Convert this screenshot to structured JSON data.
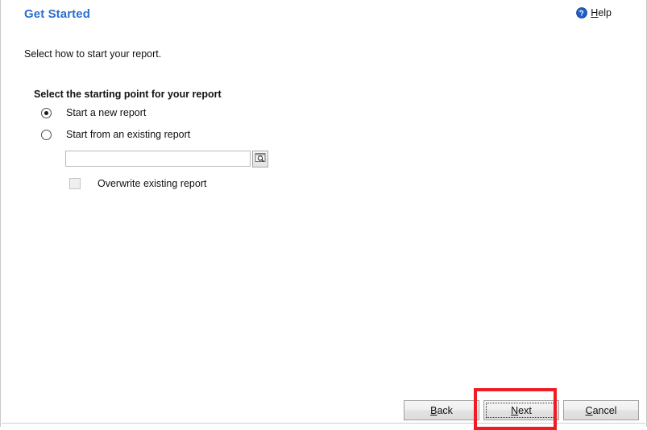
{
  "window": {
    "title": "Get Started"
  },
  "header": {
    "title": "Get Started",
    "help_label": "elp",
    "help_accel": "H",
    "help_icon": "help-circle-icon"
  },
  "main": {
    "intro_text": "Select how to start your report.",
    "group_label": "Select the starting point for your report",
    "options": [
      {
        "id": "start-new",
        "label": "Start a new report",
        "selected": true
      },
      {
        "id": "start-existing",
        "label": "Start from an existing report",
        "selected": false
      }
    ],
    "existing_report_field": {
      "value": "",
      "placeholder": "",
      "browse_icon": "browse-search-icon",
      "browse_tooltip": "Browse"
    },
    "overwrite_checkbox": {
      "label": "Overwrite existing report",
      "checked": false,
      "enabled": false
    }
  },
  "footer": {
    "buttons": [
      {
        "id": "back",
        "accel": "B",
        "rest": "ack",
        "focused": false
      },
      {
        "id": "next",
        "accel": "N",
        "rest": "ext",
        "focused": true
      },
      {
        "id": "cancel",
        "accel": "C",
        "rest": "ancel",
        "focused": false
      }
    ]
  },
  "annotation": {
    "type": "highlight-rectangle",
    "target": "next-button",
    "color": "#ee1c25"
  },
  "colors": {
    "title_blue": "#2a6fd3",
    "text": "#111111",
    "annotation_red": "#ee1c25",
    "button_border": "#9f9f9f",
    "field_border": "#b9b9b9"
  }
}
